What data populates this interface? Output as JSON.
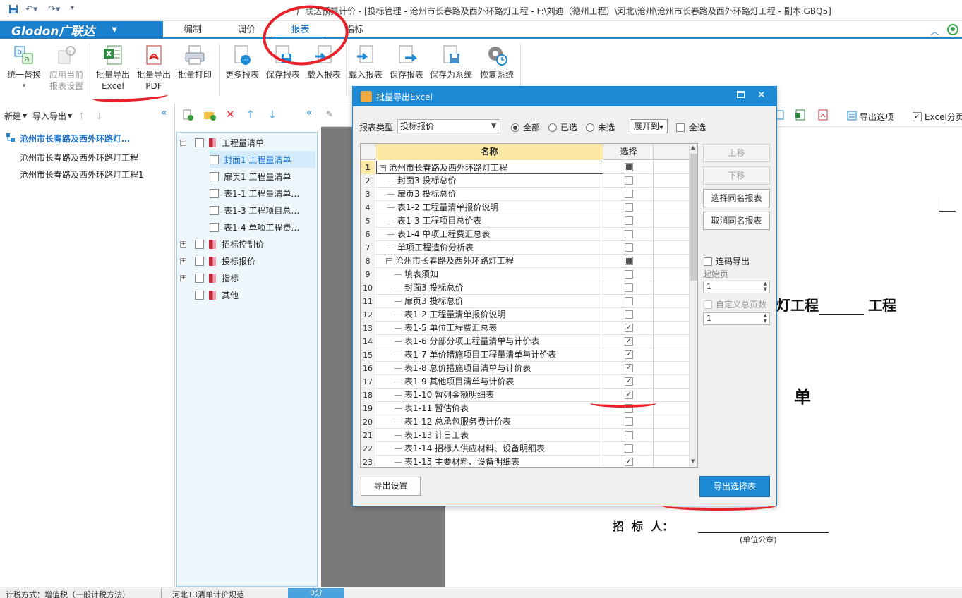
{
  "window": {
    "title": "广联达预算计价 - [投标管理 - 沧州市长春路及西外环路灯工程 - F:\\刘迪（德州工程）\\河北\\沧州\\沧州市长春路及西外环路灯工程 - 副本.GBQ5]"
  },
  "app": {
    "logo": "Glodon广联达"
  },
  "menu": {
    "items": [
      "编制",
      "调价",
      "报表",
      "指标"
    ],
    "active": "报表"
  },
  "ribbon": {
    "buttons": [
      {
        "label": "统一替换",
        "sub": "▾"
      },
      {
        "label": "应用当前",
        "sub": "报表设置"
      },
      {
        "label": "批量导出",
        "sub": "Excel"
      },
      {
        "label": "批量导出",
        "sub": "PDF"
      },
      {
        "label": "批量打印",
        "sub": ""
      },
      {
        "label": "更多报表",
        "sub": ""
      },
      {
        "label": "保存报表",
        "sub": ""
      },
      {
        "label": "载入报表",
        "sub": ""
      },
      {
        "label": "载入报表",
        "sub": ""
      },
      {
        "label": "保存报表",
        "sub": ""
      },
      {
        "label": "保存为系统",
        "sub": ""
      },
      {
        "label": "恢复系统",
        "sub": ""
      }
    ]
  },
  "left_panel": {
    "toolbar": {
      "new": "新建",
      "import_export": "导入导出"
    },
    "project_root": "沧州市长春路及西外环路灯…",
    "projects": [
      "沧州市长春路及西外环路灯工程",
      "沧州市长春路及西外环路灯工程1"
    ]
  },
  "report_tree": {
    "nodes": [
      {
        "label": "工程量清单",
        "level": 0,
        "expand": "−",
        "book": true
      },
      {
        "label": "封面1 工程量清单",
        "level": 1,
        "selected": true
      },
      {
        "label": "扉页1 工程量清单",
        "level": 1
      },
      {
        "label": "表1-1 工程量清单…",
        "level": 1
      },
      {
        "label": "表1-3 工程项目总…",
        "level": 1
      },
      {
        "label": "表1-4 单项工程费…",
        "level": 1
      },
      {
        "label": "招标控制价",
        "level": 0,
        "expand": "+",
        "book": true
      },
      {
        "label": "投标报价",
        "level": 0,
        "expand": "+",
        "book": true
      },
      {
        "label": "指标",
        "level": 0,
        "expand": "+",
        "book": true
      },
      {
        "label": "其他",
        "level": 0,
        "expand": "",
        "book": true
      }
    ]
  },
  "right_toolbar": {
    "export_options": "导出选项",
    "excel_paging": "Excel分页"
  },
  "document": {
    "title_part": "灯工程",
    "title_suffix": "工程",
    "big_char": "单",
    "tenderer_label": "招  标  人：",
    "seal_note": "(单位公章)"
  },
  "dialog": {
    "title": "批量导出Excel",
    "report_type_label": "报表类型",
    "report_type_value": "投标报价",
    "radios": [
      {
        "label": "全部",
        "checked": true
      },
      {
        "label": "已选",
        "checked": false
      },
      {
        "label": "未选",
        "checked": false
      }
    ],
    "expand_to": "展开到",
    "select_all": "全选",
    "columns": {
      "name": "名称",
      "select": "选择"
    },
    "rows": [
      {
        "n": "1",
        "name": "沧州市长春路及西外环路灯工程",
        "level": 0,
        "tog": "−",
        "sel": "partial"
      },
      {
        "n": "2",
        "name": "封面3 投标总价",
        "level": 1,
        "sel": "no"
      },
      {
        "n": "3",
        "name": "扉页3 投标总价",
        "level": 1,
        "sel": "no"
      },
      {
        "n": "4",
        "name": "表1-2 工程量清单报价说明",
        "level": 1,
        "sel": "no"
      },
      {
        "n": "5",
        "name": "表1-3 工程项目总价表",
        "level": 1,
        "sel": "no"
      },
      {
        "n": "6",
        "name": "表1-4 单项工程费汇总表",
        "level": 1,
        "sel": "no"
      },
      {
        "n": "7",
        "name": "单项工程造价分析表",
        "level": 1,
        "sel": "no"
      },
      {
        "n": "8",
        "name": "沧州市长春路及西外环路灯工程",
        "level": 1,
        "tog": "−",
        "sel": "partial"
      },
      {
        "n": "9",
        "name": "填表须知",
        "level": 2,
        "sel": "no"
      },
      {
        "n": "10",
        "name": "封面3 投标总价",
        "level": 2,
        "sel": "no"
      },
      {
        "n": "11",
        "name": "扉页3 投标总价",
        "level": 2,
        "sel": "no"
      },
      {
        "n": "12",
        "name": "表1-2 工程量清单报价说明",
        "level": 2,
        "sel": "no"
      },
      {
        "n": "13",
        "name": "表1-5 单位工程费汇总表",
        "level": 2,
        "sel": "yes"
      },
      {
        "n": "14",
        "name": "表1-6 分部分项工程量清单与计价表",
        "level": 2,
        "sel": "yes"
      },
      {
        "n": "15",
        "name": "表1-7 单价措施项目工程量清单与计价表",
        "level": 2,
        "sel": "yes"
      },
      {
        "n": "16",
        "name": "表1-8 总价措施项目清单与计价表",
        "level": 2,
        "sel": "yes"
      },
      {
        "n": "17",
        "name": "表1-9 其他项目清单与计价表",
        "level": 2,
        "sel": "yes"
      },
      {
        "n": "18",
        "name": "表1-10 暂列金额明细表",
        "level": 2,
        "sel": "yes"
      },
      {
        "n": "19",
        "name": "表1-11 暂估价表",
        "level": 2,
        "sel": "no"
      },
      {
        "n": "20",
        "name": "表1-12 总承包服务费计价表",
        "level": 2,
        "sel": "no"
      },
      {
        "n": "21",
        "name": "表1-13 计日工表",
        "level": 2,
        "sel": "no"
      },
      {
        "n": "22",
        "name": "表1-14 招标人供应材料、设备明细表",
        "level": 2,
        "sel": "no"
      },
      {
        "n": "23",
        "name": "表1-15 主要材料、设备明细表",
        "level": 2,
        "sel": "yes"
      }
    ],
    "side_buttons": {
      "move_up": "上移",
      "move_down": "下移",
      "select_same": "选择同名报表",
      "cancel_same": "取消同名报表"
    },
    "continuous_export": "连码导出",
    "start_page_label": "起始页",
    "start_page_value": "1",
    "custom_total_label": "自定义总页数",
    "custom_total_value": "1",
    "export_settings": "导出设置",
    "export_selected": "导出选择表"
  },
  "status": {
    "tax_mode": "计税方式：增值税（一般计税方法）",
    "standard": "河北13清单计价规范",
    "score": "0分"
  },
  "colors": {
    "accent": "#1d8ad6",
    "annotation_red": "#e8202a",
    "tree_bg": "#eef7fc"
  }
}
